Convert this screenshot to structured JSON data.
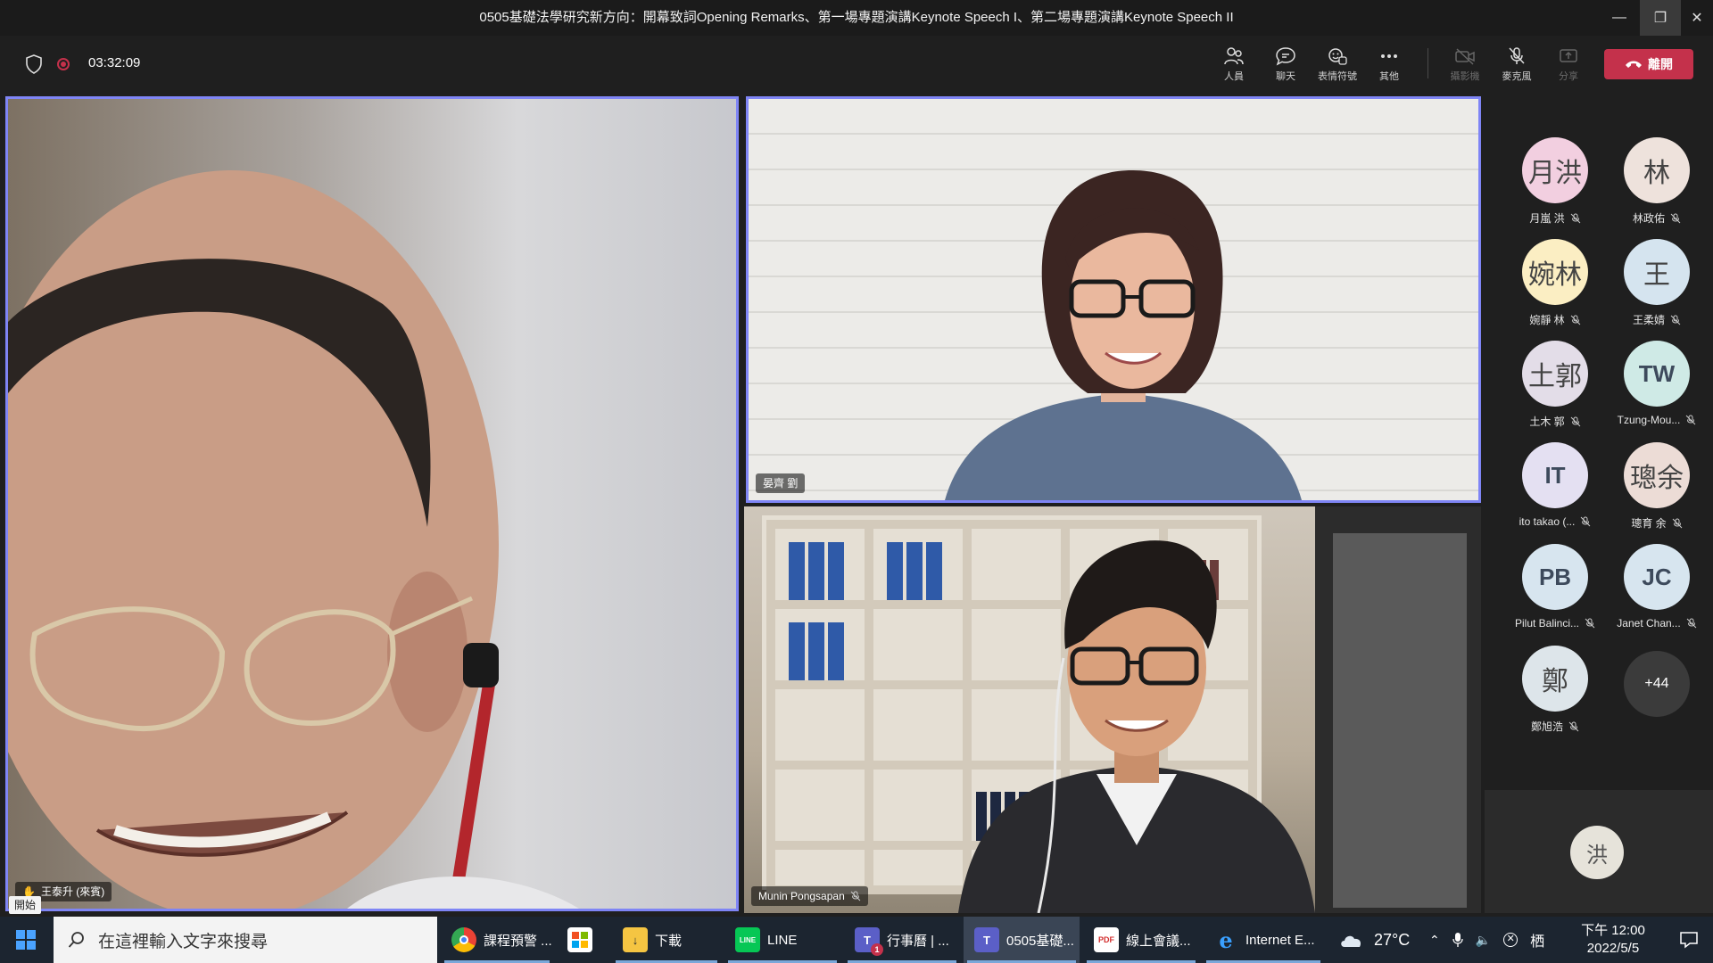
{
  "window": {
    "title": "0505基礎法學研究新方向：開幕致詞Opening Remarks、第一場專題演講Keynote Speech I、第二場專題演講Keynote Speech II"
  },
  "meeting": {
    "timer": "03:32:09",
    "toolbar": {
      "people": "人員",
      "chat": "聊天",
      "react": "表情符號",
      "more": "其他",
      "camera": "攝影機",
      "mic": "麥克風",
      "share": "分享",
      "leave": "離開"
    },
    "tiles": {
      "main_speaker": "王泰升 (來賓)",
      "speaker2": "晏齊 劉",
      "speaker3": "Munin Pongsapan"
    },
    "start_label": "開始",
    "participants": [
      {
        "initials": "月洪",
        "name": "月嵐 洪",
        "color": "#f2cfe0"
      },
      {
        "initials": "林",
        "name": "林政佑",
        "color": "#eee2dc"
      },
      {
        "initials": "婉林",
        "name": "婉靜 林",
        "color": "#fbeec3"
      },
      {
        "initials": "王",
        "name": "王柔婧",
        "color": "#d5e4ef"
      },
      {
        "initials": "土郭",
        "name": "土木 郭",
        "color": "#e3dde8"
      },
      {
        "initials": "TW",
        "name": "Tzung-Mou...",
        "color": "#cfeae6"
      },
      {
        "initials": "IT",
        "name": "ito takao (...",
        "color": "#e4e0f2"
      },
      {
        "initials": "璁余",
        "name": "璁育 余",
        "color": "#ecdcd6"
      },
      {
        "initials": "PB",
        "name": "Pilut Balinci...",
        "color": "#d7e5ef"
      },
      {
        "initials": "JC",
        "name": "Janet Chan...",
        "color": "#d7e5ef"
      },
      {
        "initials": "鄭",
        "name": "鄭旭浩",
        "color": "#dde5ea"
      }
    ],
    "more_count": "+44",
    "self_initial": "洪"
  },
  "taskbar": {
    "search_placeholder": "在這裡輸入文字來搜尋",
    "apps": [
      {
        "label": "課程預警 ...",
        "icon": "chrome-icon"
      },
      {
        "label": "",
        "icon": "store-icon"
      },
      {
        "label": "下載",
        "icon": "folder-icon"
      },
      {
        "label": "LINE",
        "icon": "line-icon"
      },
      {
        "label": "行事曆 | ...",
        "icon": "teams-icon"
      },
      {
        "label": "0505基礎...",
        "icon": "teams-icon"
      },
      {
        "label": "線上會議...",
        "icon": "pdf-icon"
      },
      {
        "label": "Internet E...",
        "icon": "ie-icon"
      }
    ],
    "teams_badge": "1",
    "temperature": "27°C",
    "time": "下午 12:00",
    "date": "2022/5/5"
  }
}
